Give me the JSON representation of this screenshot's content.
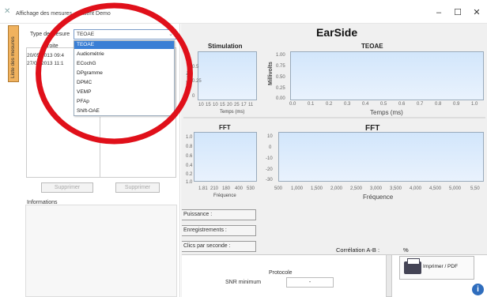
{
  "window": {
    "title": "Affichage des mesures - Patient Demo",
    "controls": [
      "–",
      "☐",
      "✕"
    ]
  },
  "left_tab": "Liste des mesures",
  "type_selector": {
    "label": "Type de mesure",
    "value": "TEOAE",
    "options": [
      "TEOAE",
      "Audiométrie",
      "ECochG",
      "DPgramme",
      "DPMC",
      "VEMP",
      "PFAp",
      "Shift-OAE"
    ]
  },
  "side_label": "Droite",
  "measures": [
    "20/05/2013 09:4",
    "27/05/2013 11:1"
  ],
  "delete_buttons": [
    "Supprimer",
    "Supprimer"
  ],
  "info_label": "Informations",
  "app_name": "EarSide",
  "stimulation": {
    "title": "Stimulation",
    "ylabel": "Millivolts",
    "yticks": [
      "0.5",
      "0.25",
      "0"
    ],
    "xticks": [
      "10",
      "15",
      "10",
      "15",
      "20",
      "25",
      "17",
      "11"
    ],
    "xlabel": "Temps (ms)"
  },
  "teoae": {
    "title": "TEOAE",
    "ylabel": "Millivolts",
    "yticks": [
      "1.00",
      "0.75",
      "0.50",
      "0.25",
      "0.00"
    ],
    "xticks": [
      "0.0",
      "0.1",
      "0.2",
      "0.3",
      "0.4",
      "0.5",
      "0.6",
      "0.7",
      "0.8",
      "0.9",
      "1.0"
    ],
    "xlabel": "Temps (ms)"
  },
  "fft_small": {
    "title": "FFT",
    "yticks": [
      "1.0",
      "0.8",
      "0.6",
      "0.4",
      "0.2",
      "1.0"
    ],
    "xticks": [
      "1.81",
      "210",
      "180",
      "400",
      "530"
    ],
    "xlabel": "Fréquence"
  },
  "fft": {
    "title": "FFT",
    "yticks": [
      "10",
      "0",
      "-10",
      "-20",
      "-30"
    ],
    "xticks": [
      "500",
      "1,000",
      "1,500",
      "2,000",
      "2,500",
      "3,000",
      "3,500",
      "4,000",
      "4,500",
      "5,000",
      "5,50"
    ],
    "xlabel": "Fréquence"
  },
  "side_tabs": [
    "Puissance :",
    "Enregistrements :",
    "Clics par seconde :"
  ],
  "correlation": {
    "label": "Corrélation A-B :",
    "value": "%"
  },
  "protocol": {
    "label": "Protocole",
    "snr_label": "SNR minimum",
    "snr_value": "-"
  },
  "print_label": "Imprimer / PDF",
  "info_icon": "i",
  "app_icon": "app-logo-icon",
  "colors": {
    "accent": "#3a7fd5",
    "plot_fill": "#d2e6fb",
    "annotation": "#e0101a",
    "tab": "#f0b25e"
  }
}
